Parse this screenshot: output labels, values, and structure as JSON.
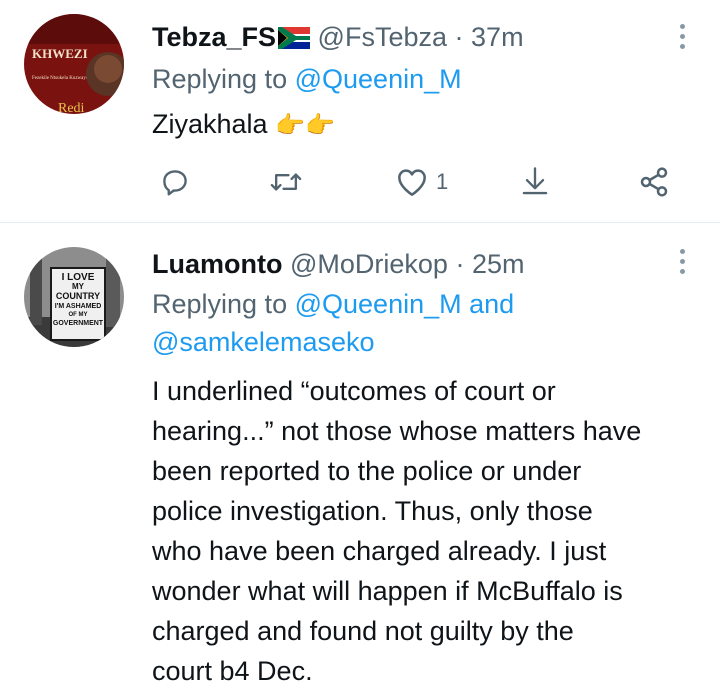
{
  "tweets": [
    {
      "display_name": "Tebza_FS",
      "handle": "@FsTebza",
      "separator": "·",
      "time": "37m",
      "replying_label": "Replying to",
      "replying_to": "@Queenin_M",
      "text": "Ziyakhala",
      "emoji": "👉👉",
      "avatar_cover": {
        "title": "KHWEZI",
        "subtitle": "Fezekile Ntsukela Kuzwayo",
        "author": "Redi"
      },
      "like_count": "1"
    },
    {
      "display_name": "Luamonto",
      "handle": "@MoDriekop",
      "separator": "·",
      "time": "25m",
      "replying_label": "Replying to",
      "replying_to": "@Queenin_M",
      "replying_and": "and",
      "replying_to_2": "@samkelemaseko",
      "avatar_sign": [
        "I LOVE",
        "MY",
        "COUNTRY",
        "I'M ASHAMED",
        "OF MY",
        "GOVERNMENT"
      ],
      "lines": [
        "I underlined “outcomes of court or",
        "hearing...” not those whose matters have",
        "been reported to the police or under",
        "police investigation. Thus, only those",
        "who have been charged already. I just",
        "wonder what will happen if McBuffalo is",
        "charged and found not guilty by the",
        "court b4 Dec."
      ]
    }
  ],
  "icons": {
    "more": "more-vertical-icon",
    "reply": "reply-icon",
    "retweet": "retweet-icon",
    "like": "heart-icon",
    "bookmark": "bookmark-download-icon",
    "share": "share-icon",
    "flag": "south-africa-flag-icon"
  },
  "colors": {
    "link": "#1d9bf0",
    "muted": "#536471",
    "text": "#0f1419",
    "divider": "#e6ecf0"
  }
}
